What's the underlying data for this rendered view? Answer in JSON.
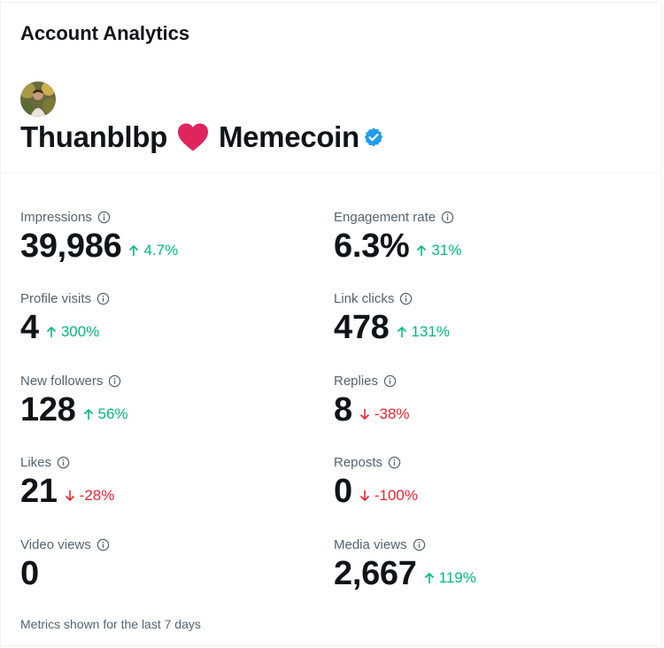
{
  "header": {
    "title": "Account Analytics"
  },
  "account": {
    "name_part1": "Thuanblbp",
    "name_part2": "Memecoin",
    "verified": true
  },
  "metrics": {
    "impressions": {
      "label": "Impressions",
      "value": "39,986",
      "delta": "4.7%",
      "trend": "up"
    },
    "engagement_rate": {
      "label": "Engagement rate",
      "value": "6.3%",
      "delta": "31%",
      "trend": "up"
    },
    "profile_visits": {
      "label": "Profile visits",
      "value": "4",
      "delta": "300%",
      "trend": "up"
    },
    "link_clicks": {
      "label": "Link clicks",
      "value": "478",
      "delta": "131%",
      "trend": "up"
    },
    "new_followers": {
      "label": "New followers",
      "value": "128",
      "delta": "56%",
      "trend": "up"
    },
    "replies": {
      "label": "Replies",
      "value": "8",
      "delta": "-38%",
      "trend": "down"
    },
    "likes": {
      "label": "Likes",
      "value": "21",
      "delta": "-28%",
      "trend": "down"
    },
    "reposts": {
      "label": "Reposts",
      "value": "0",
      "delta": "-100%",
      "trend": "down"
    },
    "video_views": {
      "label": "Video views",
      "value": "0",
      "delta": "",
      "trend": "none"
    },
    "media_views": {
      "label": "Media views",
      "value": "2,667",
      "delta": "119%",
      "trend": "up"
    }
  },
  "footer": {
    "note": "Metrics shown for the last 7 days"
  },
  "colors": {
    "up": "#00ba7c",
    "down": "#f4212e",
    "text": "#0f1419",
    "muted": "#536471",
    "verified": "#1d9bf0",
    "heart": "#e0245e"
  },
  "icons": {
    "info": "info-icon",
    "arrow_up": "arrow-up-icon",
    "arrow_down": "arrow-down-icon",
    "verified": "verified-badge-icon",
    "heart": "heart-icon"
  }
}
